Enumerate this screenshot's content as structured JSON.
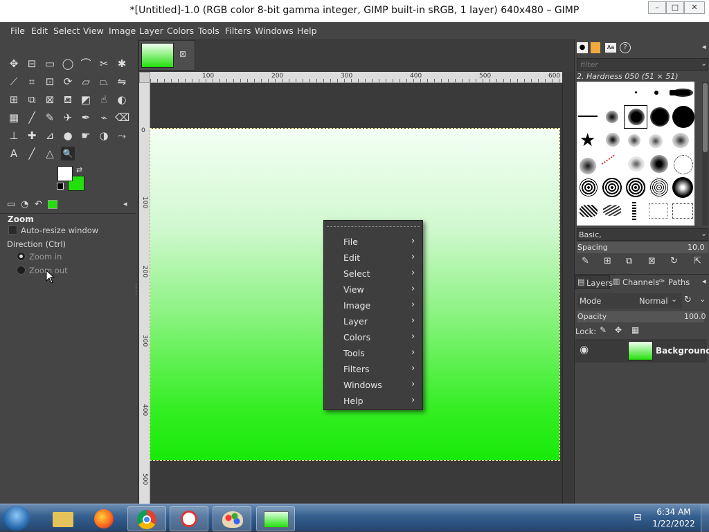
{
  "window": {
    "title": "*[Untitled]-1.0 (RGB color 8-bit gamma integer, GIMP built-in sRGB, 1 layer) 640x480 – GIMP",
    "controls": [
      "minimize-icon",
      "maximize-icon",
      "close-icon"
    ]
  },
  "menubar": [
    "File",
    "Edit",
    "Select",
    "View",
    "Image",
    "Layer",
    "Colors",
    "Tools",
    "Filters",
    "Windows",
    "Help"
  ],
  "toolbox": {
    "tools": [
      "move-icon",
      "align-icon",
      "rect-select-icon",
      "ellipse-select-icon",
      "free-select-icon",
      "scissors-icon",
      "fuzzy-select-icon",
      "wand-icon",
      "crop-icon",
      "unified-transform-icon",
      "rotate-icon",
      "shear-icon",
      "perspective-icon",
      "flip-icon",
      "cage-icon",
      "warp-icon",
      "handle-transform-icon",
      "bucket-icon",
      "gradient-icon",
      "smudge-icon",
      "dodge-icon",
      "pattern-icon",
      "paintbrush-icon",
      "pencil-icon",
      "airbrush-icon",
      "ink-icon",
      "mypaint-icon",
      "eraser-icon",
      "clone-icon",
      "heal-icon",
      "perspective-clone-icon",
      "blur-icon",
      "smudge2-icon",
      "dodge2-icon",
      "paths-icon",
      "text-icon",
      "color-picker-icon",
      "measure-icon",
      "zoom-icon"
    ],
    "fg_color": "#ffffff",
    "bg_color": "#22e00a"
  },
  "tool_options": {
    "title": "Zoom",
    "auto_resize_label": "Auto-resize window",
    "direction_label": "Direction  (Ctrl)",
    "zoom_in_label": "Zoom in",
    "zoom_out_label": "Zoom out"
  },
  "rulers": {
    "h_ticks": [
      "100",
      "200",
      "300",
      "400",
      "500",
      "600"
    ],
    "v_ticks": [
      "0",
      "100",
      "200",
      "300",
      "400",
      "500"
    ]
  },
  "context_menu": [
    "File",
    "Edit",
    "Select",
    "View",
    "Image",
    "Layer",
    "Colors",
    "Tools",
    "Filters",
    "Windows",
    "Help"
  ],
  "brushes_panel": {
    "filter_placeholder": "filter",
    "selected_brush": "2. Hardness 050 (51 × 51)",
    "tag": "Basic,",
    "spacing_label": "Spacing",
    "spacing_value": "10.0"
  },
  "layers_panel": {
    "tabs": [
      "Layers",
      "Channels",
      "Paths"
    ],
    "mode_label": "Mode",
    "mode_value": "Normal",
    "opacity_label": "Opacity",
    "opacity_value": "100.0",
    "lock_label": "Lock:",
    "layers": [
      {
        "name": "Background",
        "visible": true
      }
    ]
  },
  "taskbar": {
    "apps": [
      "start-orb-icon",
      "file-explorer-icon",
      "firefox-icon",
      "chrome-icon",
      "snipping-tool-icon",
      "paint-icon",
      "gimp-icon"
    ],
    "time": "6:34 AM",
    "date": "1/22/2022"
  }
}
